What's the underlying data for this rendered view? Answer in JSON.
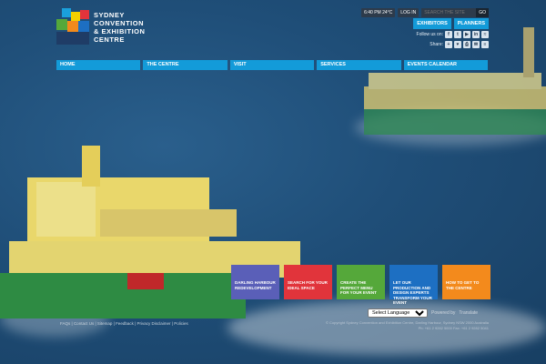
{
  "logo": {
    "line1": "SYDNEY",
    "line2": "CONVENTION",
    "line3": "& EXHIBITION",
    "line4": "CENTRE"
  },
  "topbar": {
    "time": "6:40 PM",
    "temp": "24°C",
    "login": "LOG IN",
    "search_placeholder": "SEARCH THE SITE",
    "search_go": "GO"
  },
  "cta": {
    "exhibitors": "EXHIBITORS",
    "planners": "PLANNERS"
  },
  "social": {
    "follow_label": "Follow us on:",
    "share_label": "Share:"
  },
  "nav": [
    "HOME",
    "THE CENTRE",
    "VISIT",
    "SERVICES",
    "EVENTS CALENDAR"
  ],
  "tiles": [
    {
      "label": "DARLING HARBOUR REDEVELOPMENT",
      "color": "#5a5fb8"
    },
    {
      "label": "SEARCH FOR YOUR IDEAL SPACE",
      "color": "#e1343b"
    },
    {
      "label": "CREATE THE PERFECT MENU FOR YOUR EVENT",
      "color": "#55a83a"
    },
    {
      "label": "LET OUR PRODUCTION AND DESIGN EXPERTS TRANSFORM YOUR EVENT",
      "color": "#1d6fc2"
    },
    {
      "label": "HOW TO GET TO THE CENTRE",
      "color": "#f38a1c"
    }
  ],
  "language": {
    "selected": "Select Language",
    "powered": "Powered by",
    "translate": "Translate"
  },
  "footer": [
    "FAQs",
    "Contact Us",
    "Sitemap",
    "Feedback",
    "Privacy Disclaimer",
    "Policies"
  ],
  "copyright": {
    "line1": "© Copyright Sydney Convention and Exhibition Centre, Darling Harbour, Sydney NSW 2000 Australia",
    "line2": "Ph: +61 2 9282 5000  Fax: +61 2 9282 5041"
  }
}
